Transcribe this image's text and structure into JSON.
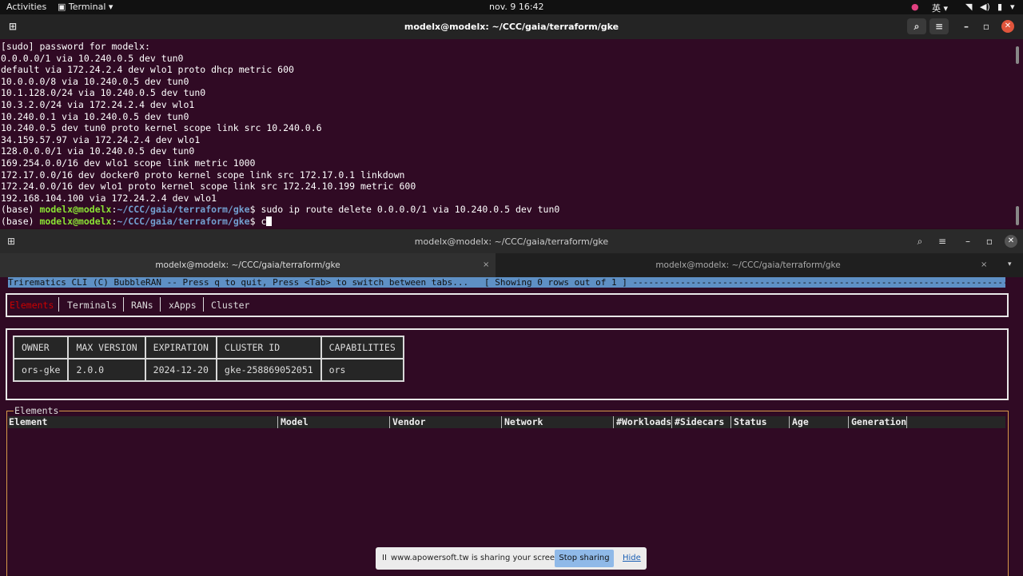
{
  "topbar": {
    "activities": "Activities",
    "app_name": "Terminal",
    "clock": "nov. 9  16:42",
    "ime": "英"
  },
  "window1": {
    "title": "modelx@modelx: ~/CCC/gaia/terraform/gke",
    "output_lines": [
      "[sudo] password for modelx:",
      "0.0.0.0/1 via 10.240.0.5 dev tun0",
      "default via 172.24.2.4 dev wlo1 proto dhcp metric 600",
      "10.0.0.0/8 via 10.240.0.5 dev tun0",
      "10.1.128.0/24 via 10.240.0.5 dev tun0",
      "10.3.2.0/24 via 172.24.2.4 dev wlo1",
      "10.240.0.1 via 10.240.0.5 dev tun0",
      "10.240.0.5 dev tun0 proto kernel scope link src 10.240.0.6",
      "34.159.57.97 via 172.24.2.4 dev wlo1",
      "128.0.0.0/1 via 10.240.0.5 dev tun0",
      "169.254.0.0/16 dev wlo1 scope link metric 1000",
      "172.17.0.0/16 dev docker0 proto kernel scope link src 172.17.0.1 linkdown",
      "172.24.0.0/16 dev wlo1 proto kernel scope link src 172.24.10.199 metric 600",
      "192.168.104.100 via 172.24.2.4 dev wlo1"
    ],
    "prompt_env": "(base) ",
    "prompt_user": "modelx@modelx",
    "prompt_colon": ":",
    "prompt_path": "~/CCC/gaia/terraform/gke",
    "prompt_dollar": "$ ",
    "cmd1": "sudo ip route delete 0.0.0.0/1 via 10.240.0.5 dev tun0",
    "cmd2": "c"
  },
  "window2": {
    "title": "modelx@modelx: ~/CCC/gaia/terraform/gke",
    "tabs": [
      {
        "label": "modelx@modelx: ~/CCC/gaia/terraform/gke"
      },
      {
        "label": "modelx@modelx: ~/CCC/gaia/terraform/gke"
      }
    ],
    "cli_header": "Trirematics CLI (C) BubbleRAN -- Press q to quit, Press <Tab> to switch between tabs...   [ Showing 0 rows out of 1 ] --------------------------------------------------------------------------------------------------------",
    "menu": [
      "Elements",
      "Terminals",
      "RANs",
      "xApps",
      "Cluster"
    ],
    "info_table": {
      "headers": [
        "OWNER",
        "MAX VERSION",
        "EXPIRATION",
        "CLUSTER ID",
        "CAPABILITIES"
      ],
      "row": [
        "ors-gke",
        "2.0.0",
        "2024-12-20",
        "gke-258869052051",
        "ors"
      ]
    },
    "elements_title": "Elements",
    "elements_columns": [
      "Element",
      "Model",
      "Vendor",
      "Network",
      "#Workloads",
      "#Sidecars",
      "Status",
      "Age",
      "Generation"
    ]
  },
  "share_bar": {
    "pause": "II",
    "message": "www.apowersoft.tw is sharing your screen.",
    "stop": "Stop sharing",
    "hide": "Hide"
  }
}
